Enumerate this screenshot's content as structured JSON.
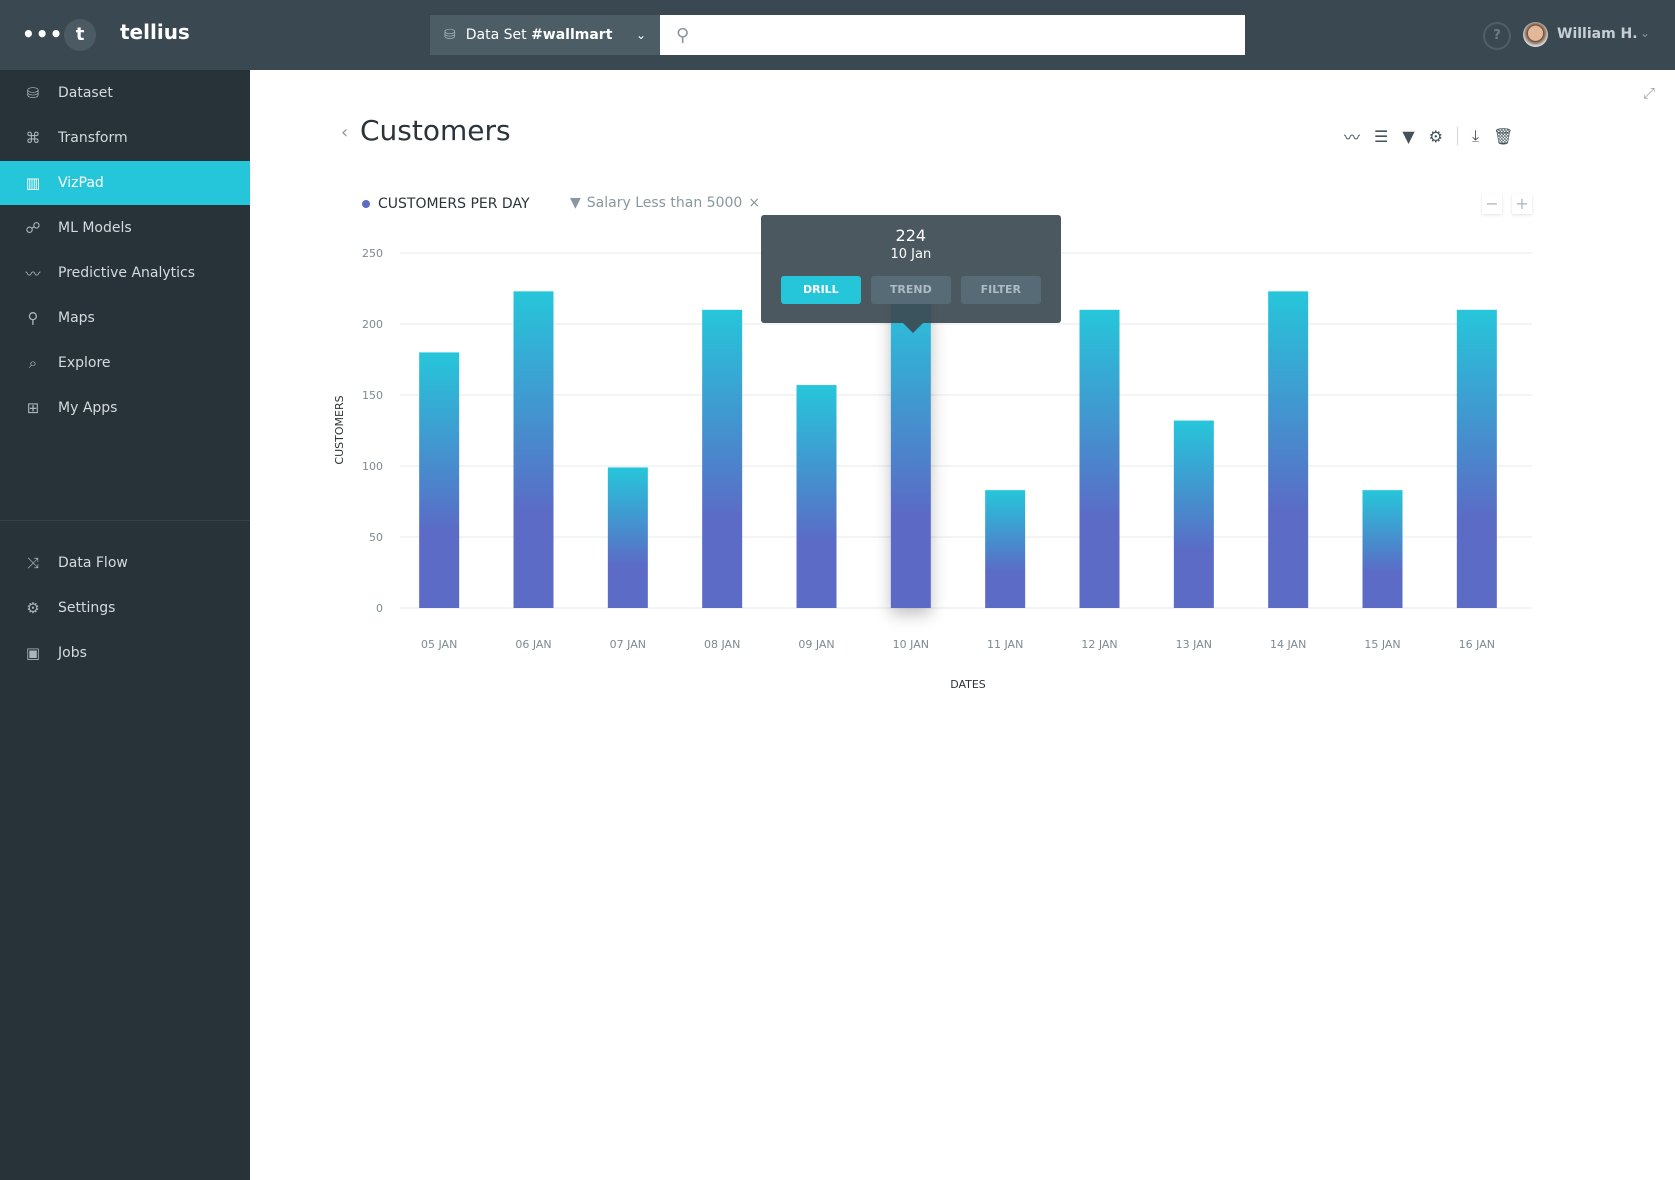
{
  "header": {
    "menu_icon": "ellipsis-icon",
    "logo_letter": "t",
    "brand": "tellius",
    "dataset_label": "Data Set ",
    "dataset_name": "#wallmart",
    "search_placeholder": "",
    "help": "?",
    "user": "William H."
  },
  "sidebar": {
    "items": [
      {
        "label": "Dataset",
        "icon": "⛁"
      },
      {
        "label": "Transform",
        "icon": "⌘"
      },
      {
        "label": "VizPad",
        "icon": "▥",
        "active": true
      },
      {
        "label": "ML Models",
        "icon": "☍"
      },
      {
        "label": "Predictive Analytics",
        "icon": "〰"
      },
      {
        "label": "Maps",
        "icon": "⚲"
      },
      {
        "label": "Explore",
        "icon": "⌕"
      },
      {
        "label": "My Apps",
        "icon": "⊞"
      }
    ],
    "items2": [
      {
        "label": "Data Flow",
        "icon": "⤨"
      },
      {
        "label": "Settings",
        "icon": "⚙"
      },
      {
        "label": "Jobs",
        "icon": "▣"
      }
    ]
  },
  "page": {
    "title": "Customers",
    "legend": "CUSTOMERS PER DAY",
    "filter": "Salary Less than 5000",
    "filter_remove": "×",
    "zoom_out": "−",
    "zoom_in": "+"
  },
  "tooltip": {
    "value": "224",
    "date": "10 Jan",
    "buttons": [
      "DRILL",
      "TREND",
      "FILTER"
    ]
  },
  "colors": {
    "accent": "#26c6da",
    "bar_top": "#26c6da",
    "bar_bottom": "#5b6bc6"
  },
  "chart_data": {
    "type": "bar",
    "categories": [
      "05 JAN",
      "06 JAN",
      "07 JAN",
      "08 JAN",
      "09 JAN",
      "10 JAN",
      "11 JAN",
      "12 JAN",
      "13 JAN",
      "14 JAN",
      "15 JAN",
      "16 JAN"
    ],
    "values": [
      180,
      223,
      99,
      210,
      157,
      224,
      83,
      210,
      132,
      223,
      83,
      210
    ],
    "xlabel": "DATES",
    "ylabel": "CUSTOMERS",
    "ylim": [
      0,
      250
    ],
    "yticks": [
      0,
      50,
      100,
      150,
      200,
      250
    ],
    "grid": true,
    "highlighted": "10 JAN"
  }
}
